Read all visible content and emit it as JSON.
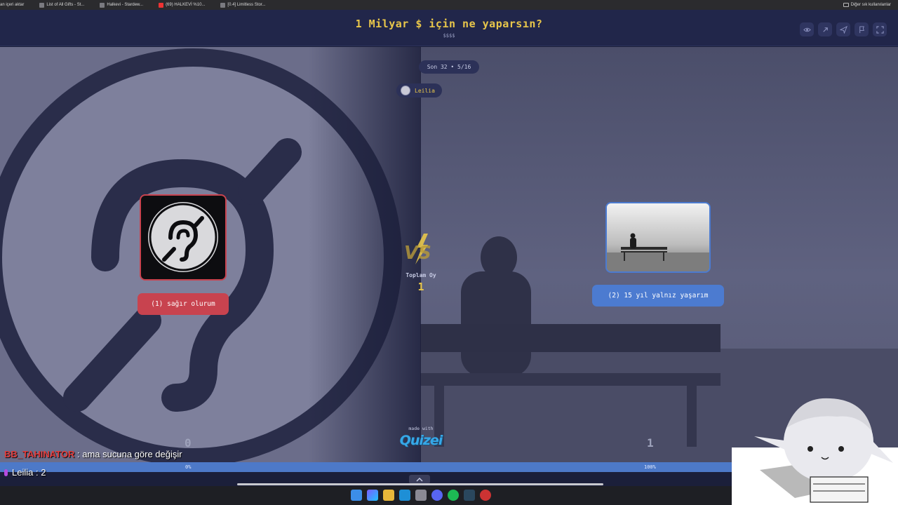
{
  "bookmarks": [
    {
      "label": "an içeri aktar"
    },
    {
      "label": "List of All Gifts - St..."
    },
    {
      "label": "Halkevi - Stardew..."
    },
    {
      "label": "(69) HALKEVİ %10..."
    },
    {
      "label": "[0.4] Limitless Stor..."
    }
  ],
  "bookmarks_other": "Diğer sık kullanılanlar",
  "header": {
    "title": "1 Milyar $ için ne yaparsın?",
    "subtitle": "$$$$"
  },
  "round": {
    "label": "Son 32 • 5/16"
  },
  "current_user": {
    "name": "Leilia"
  },
  "options": [
    {
      "label": "(1) sağır olurum",
      "votes": "0",
      "percent": "0%",
      "color": "#c8434f"
    },
    {
      "label": "(2) 15 yıl yalnız yaşarım",
      "votes": "1",
      "percent": "100%",
      "color": "#4c7bd0"
    }
  ],
  "totals": {
    "label": "Toplam Oy",
    "value": "1"
  },
  "footer": {
    "made_with": "made with",
    "brand": "Quizei"
  },
  "progress": {
    "left_fraction": 0.0
  },
  "chat": [
    {
      "name": "BB_TAHINATOR",
      "message": ": ama sucuna göre değişir"
    },
    {
      "name": "Leilia",
      "message": ": 2"
    }
  ],
  "colors": {
    "accent_yellow": "#e8c64a",
    "header_bg": "#21264a",
    "option1": "#c8434f",
    "option2": "#4c7bd0"
  }
}
